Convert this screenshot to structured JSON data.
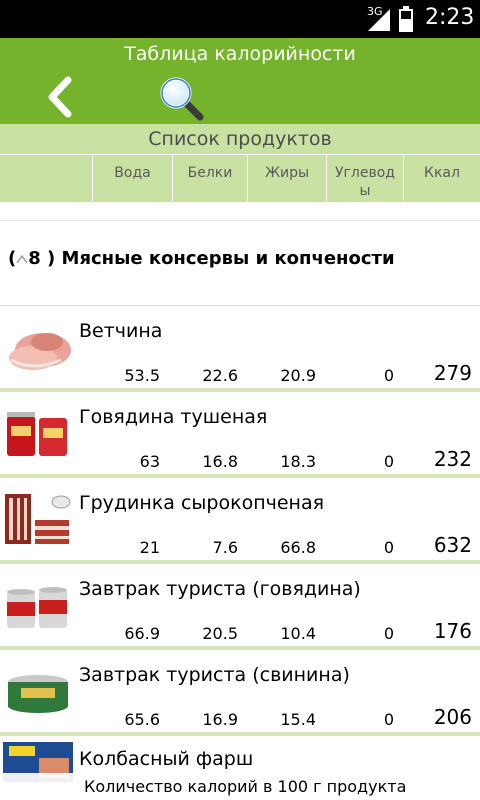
{
  "status": {
    "network": "3G",
    "time": "2:23"
  },
  "app": {
    "title": "Таблица калорийности"
  },
  "list_title": "Список продуктов",
  "columns": [
    {
      "label": ""
    },
    {
      "label": "Вода"
    },
    {
      "label": "Белки"
    },
    {
      "label": "Жиры"
    },
    {
      "label": "Углевод\nы"
    },
    {
      "label": "Ккал"
    }
  ],
  "category": {
    "prefix": "(",
    "number": "8",
    "suffix": " ) Мясные консервы и копчености"
  },
  "rows": [
    {
      "name": "Ветчина",
      "water": "53.5",
      "protein": "22.6",
      "fat": "20.9",
      "carbs": "0",
      "kcal": "279",
      "icon": "ham-image"
    },
    {
      "name": "Говядина тушеная",
      "water": "63",
      "protein": "16.8",
      "fat": "18.3",
      "carbs": "0",
      "kcal": "232",
      "icon": "stewed-beef-can-image"
    },
    {
      "name": "Грудинка сырокопченая",
      "water": "21",
      "protein": "7.6",
      "fat": "66.8",
      "carbs": "0",
      "kcal": "632",
      "icon": "brisket-image"
    },
    {
      "name": "Завтрак туриста (говядина)",
      "water": "66.9",
      "protein": "20.5",
      "fat": "10.4",
      "carbs": "0",
      "kcal": "176",
      "icon": "tourist-breakfast-beef-can-image"
    },
    {
      "name": "Завтрак туриста (свинина)",
      "water": "65.6",
      "protein": "16.9",
      "fat": "15.4",
      "carbs": "0",
      "kcal": "206",
      "icon": "tourist-breakfast-pork-can-image"
    }
  ],
  "partial_row": {
    "name": "Колбасный фарш",
    "icon": "spam-can-image"
  },
  "footer": "Количество калорий в 100 г продукта",
  "colors": {
    "accent": "#74b32b",
    "header_bg": "#c9e1a3",
    "row_separator": "#d5e8bb"
  }
}
